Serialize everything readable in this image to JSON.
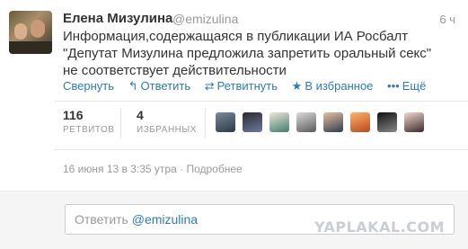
{
  "tweet": {
    "author_name": "Елена Мизулина",
    "author_handle": "@emizulina",
    "time_ago": "6 ч",
    "text": "Информация,содержащаяся в публикации ИА Росбалт \"Депутат Мизулина предложила запретить оральный секс\" не соответствует действительности"
  },
  "actions": {
    "collapse": "Свернуть",
    "reply": "Ответить",
    "retweet": "Ретвитнуть",
    "favorite": "В избранное",
    "more": "Ещё"
  },
  "icons": {
    "reply": "reply-arrow-icon",
    "retweet": "retweet-icon",
    "favorite": "star-icon",
    "more": "more-dots-icon"
  },
  "stats": {
    "retweets_count": "116",
    "retweets_label": "РЕТВИТОВ",
    "favorites_count": "4",
    "favorites_label": "ИЗБРАННЫХ"
  },
  "meta": {
    "timestamp": "16 июня 13 в 3:35 утра",
    "separator": " · ",
    "details_link": "Подробнее"
  },
  "reply": {
    "prefix": "Ответить ",
    "mention": "@emizulina"
  },
  "watermark": "YAPLAKAL.COM",
  "colors": {
    "link": "#2b7bb9",
    "muted": "#999999",
    "text": "#333333"
  }
}
